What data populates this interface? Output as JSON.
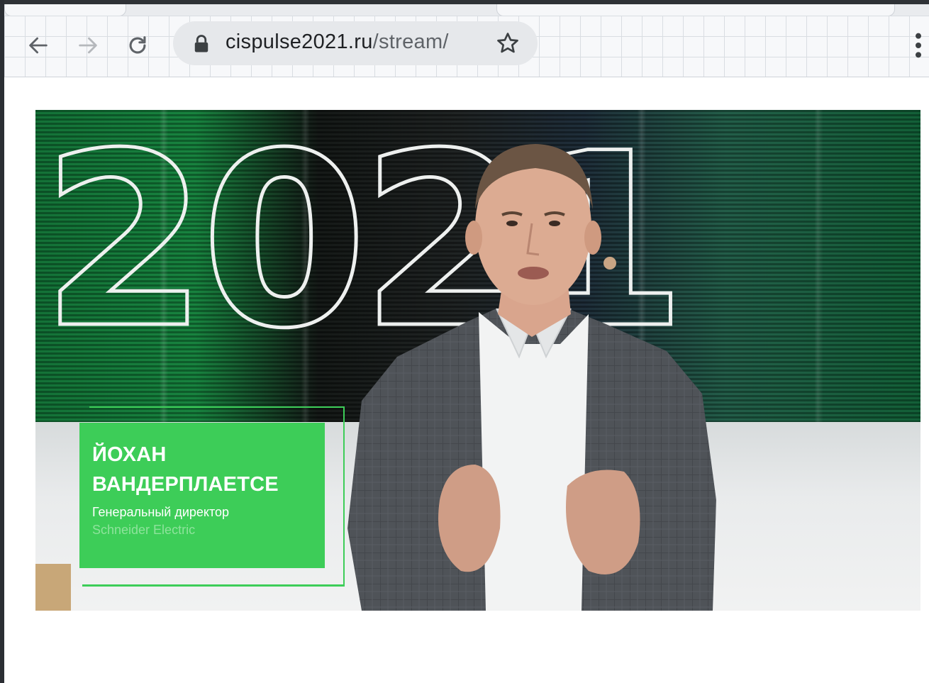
{
  "browser": {
    "url_domain": "cispulse2021.ru",
    "url_path": "/stream/",
    "icons": {
      "back": "arrow-left-icon",
      "forward": "arrow-right-icon",
      "reload": "reload-icon",
      "lock": "lock-icon",
      "bookmark": "star-icon",
      "menu": "kebab-menu-icon"
    }
  },
  "video": {
    "background_year": "2021",
    "lower_third": {
      "name": "ЙОХАН\nВАНДЕРПЛАЕТСЕ",
      "role": "Генеральный директор",
      "company": "Schneider Electric",
      "accent_color": "#3dcd58"
    }
  }
}
